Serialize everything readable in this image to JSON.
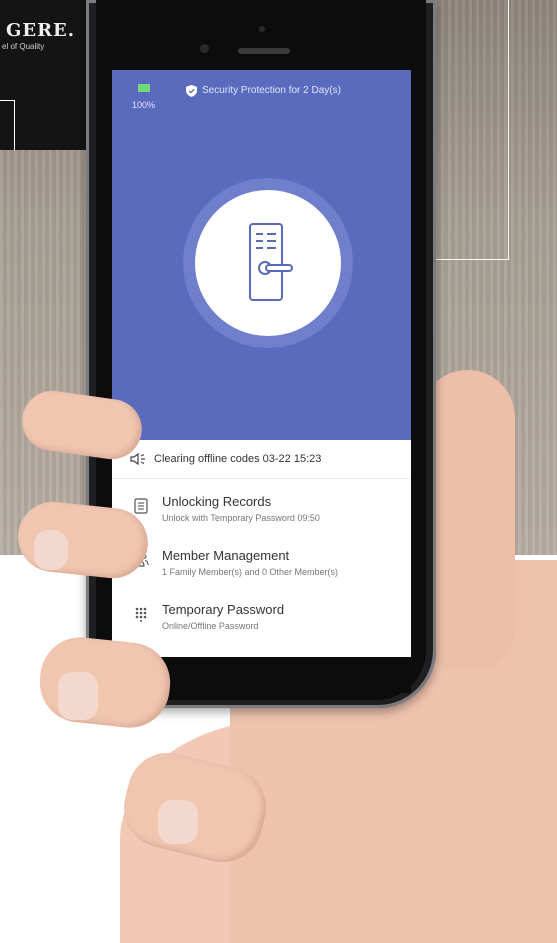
{
  "brand": {
    "name": "GERE.",
    "tagline": "el of Quality"
  },
  "status_bar": {
    "battery_percent": "100%",
    "security_text": "Security Protection for 2 Day(s)"
  },
  "lock": {
    "icon": "door-lock-icon"
  },
  "notice": {
    "icon": "speaker-icon",
    "text": "Clearing offline codes 03-22 15:23"
  },
  "menu": [
    {
      "icon": "records-icon",
      "title": "Unlocking Records",
      "subtitle": "Unlock with Temporary Password 09:50"
    },
    {
      "icon": "members-icon",
      "title": "Member Management",
      "subtitle": "1 Family Member(s) and 0 Other Member(s)"
    },
    {
      "icon": "keypad-icon",
      "title": "Temporary Password",
      "subtitle": "Online/Offline Password"
    }
  ],
  "colors": {
    "screen_bg": "#5a6bbd",
    "ring": "#6f7fcc",
    "battery": "#6fdc7c"
  }
}
